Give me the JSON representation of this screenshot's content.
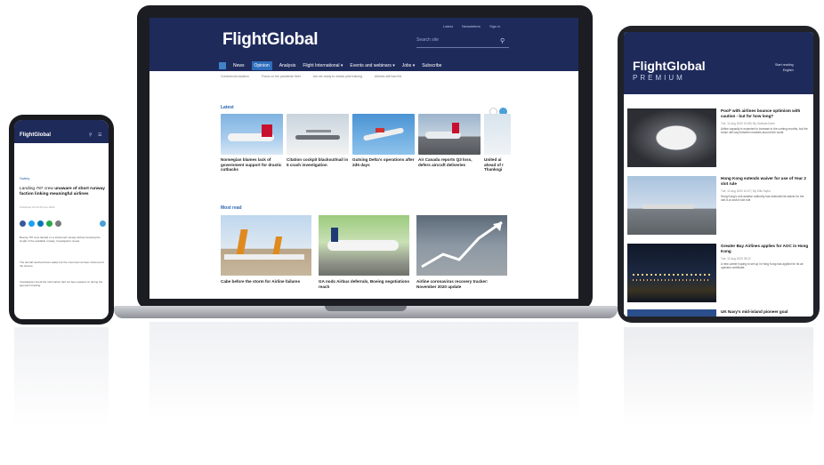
{
  "laptop": {
    "logo": "FlightGlobal",
    "search_placeholder": "Search site",
    "util_links": [
      "Latest",
      "Newsletters",
      "Sign in"
    ],
    "nav": [
      "News",
      "Opinion",
      "Analysis",
      "Flight International ▾",
      "Events and webinars ▾",
      "Jobs ▾",
      "Subscribe"
    ],
    "active_nav": "Opinion",
    "breadcrumbs": [
      "Commercial aviation",
      "Focus on the pandemic fleet",
      "Are we ready to restart pilot training",
      "Airlines still hard hit"
    ],
    "latest_title": "Latest",
    "latest_cards": [
      {
        "caption": "Norwegian blames lack of government support for drastic cutbacks"
      },
      {
        "caption": "Citation cockpit blackout/nail in 5 crash investigation"
      },
      {
        "caption": "Gutsing Delta's operations after 2d5 days"
      },
      {
        "caption": "Air Canada reports Q3 loss, defers aircraft deliveries"
      },
      {
        "caption": "United ai ahead of r Thanksgi"
      }
    ],
    "most_read_title": "Most read",
    "most_read_cards": [
      {
        "caption": "Cabe before the storm for Airline failures"
      },
      {
        "caption": "GA nods Airbus deferrals, Boeing negotiations reach"
      },
      {
        "caption": "Airline coronavirus recovery tracker: November 2020 update"
      }
    ]
  },
  "tablet": {
    "logo": "FlightGlobal",
    "premium": "PREMIUM",
    "util": [
      "Start reading",
      "English"
    ],
    "rows": [
      {
        "title": "Pool* with airlines bounce optimism with caution - but for how long?",
        "meta": "Tue, 11 Aug 2020 10:58 | By Graham Dunn",
        "body": "Airline capacity is expected to increase in the coming months, but the return will vary between markets around the world."
      },
      {
        "title": "Hong Kong extends waiver for use of Year 2 slot rule",
        "meta": "Tue, 11 Aug 2020 10:47 | By Ellis Taylor",
        "body": "Hong Kong's civil aviation authority has extended its waiver for the use-it-or-lose-it slot rule."
      },
      {
        "title": "Greater Bay Airlines applies for AOC in Hong Kong",
        "meta": "Tue, 11 Aug 2020 09:22",
        "body": "A new carrier hoping to set up in Hong Kong has applied for its air operator certificate."
      },
      {
        "title": "UK Navy's mid-island pioneer goal",
        "meta": "",
        "body": ""
      }
    ]
  },
  "phone": {
    "logo": "FlightGlobal",
    "section": "Safety",
    "title_plain": "Landing 787 crew ",
    "title_bold": "unaware of short runway faction linking meaningful airlines",
    "meta": "Published 16:34 09 Nov 2020",
    "paragraphs": [
      "Boeing 787 crew landed on a shortened runway without knowing the length of the available runway, investigators reveal.",
      "The aircraft touched down safely but the crew had not been informed of the closure.",
      "Investigators found the information had not been passed on during the approach briefing."
    ]
  },
  "colors": {
    "brand_navy": "#1e2a5a",
    "accent_blue": "#2966b0"
  }
}
